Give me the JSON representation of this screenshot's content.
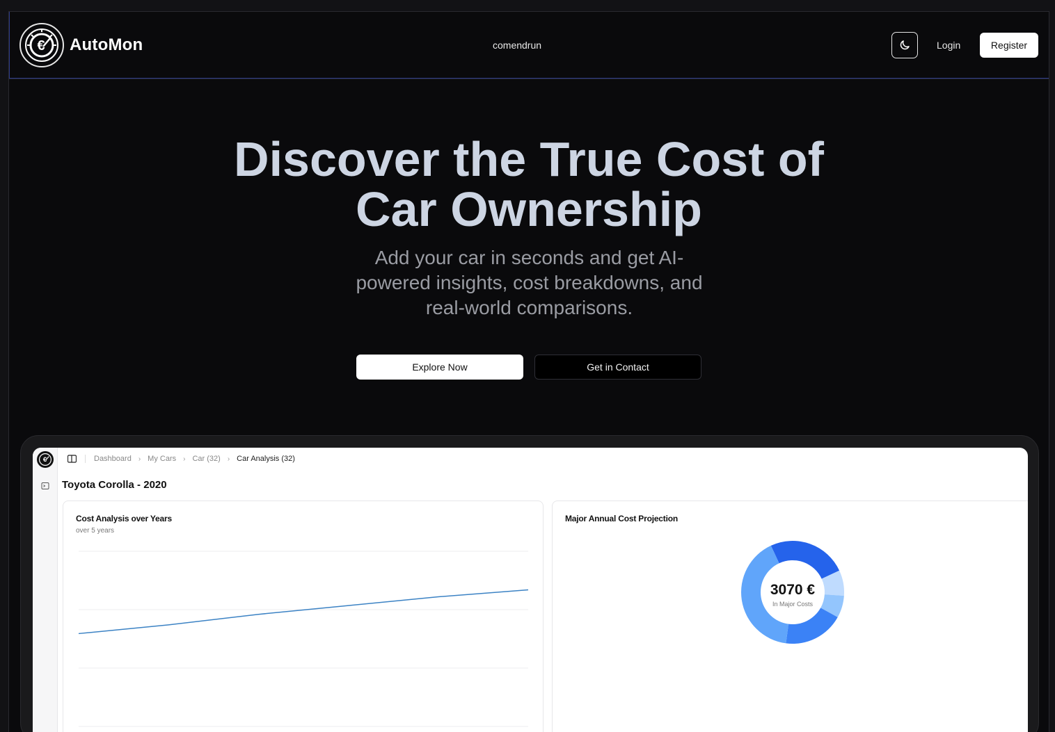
{
  "navbar": {
    "brand": "AutoMon",
    "link": "comendrun",
    "login": "Login",
    "register": "Register"
  },
  "hero": {
    "title_line1": "Discover the True Cost of",
    "title_line2": "Car Ownership",
    "subtitle_line1": "Add your car in seconds and get AI-",
    "subtitle_line2": "powered insights, cost breakdowns, and",
    "subtitle_line3": "real-world comparisons.",
    "explore_label": "Explore Now",
    "contact_label": "Get in Contact"
  },
  "preview": {
    "breadcrumbs": [
      "Dashboard",
      "My Cars",
      "Car (32)",
      "Car Analysis (32)"
    ],
    "car_title": "Toyota Corolla - 2020",
    "cost_card": {
      "title": "Cost Analysis over Years",
      "subtitle": "over 5 years"
    },
    "projection_card": {
      "title": "Major Annual Cost Projection",
      "total": "3070 €",
      "total_caption": "In Major Costs"
    }
  },
  "chart_data": [
    {
      "type": "line",
      "title": "Cost Analysis over Years",
      "subtitle": "over 5 years",
      "series": [
        {
          "values": [
            0.53,
            0.58,
            0.64,
            0.69,
            0.74,
            0.78
          ]
        }
      ],
      "ylim": [
        0,
        1
      ],
      "grid": true,
      "color": "#3b82c4"
    },
    {
      "type": "pie",
      "title": "Major Annual Cost Projection",
      "center_label": "3070 €",
      "center_caption": "In Major Costs",
      "values": [
        25,
        8,
        7,
        19,
        41
      ],
      "colors": [
        "#2563eb",
        "#bfdbfe",
        "#93c5fd",
        "#3b82f6",
        "#60a5fa"
      ]
    }
  ],
  "icons": {
    "logo": "euro-speedometer-icon",
    "theme": "moon-icon",
    "sidebar_toggle": "sidebar-toggle-icon",
    "terminal": "terminal-icon"
  }
}
